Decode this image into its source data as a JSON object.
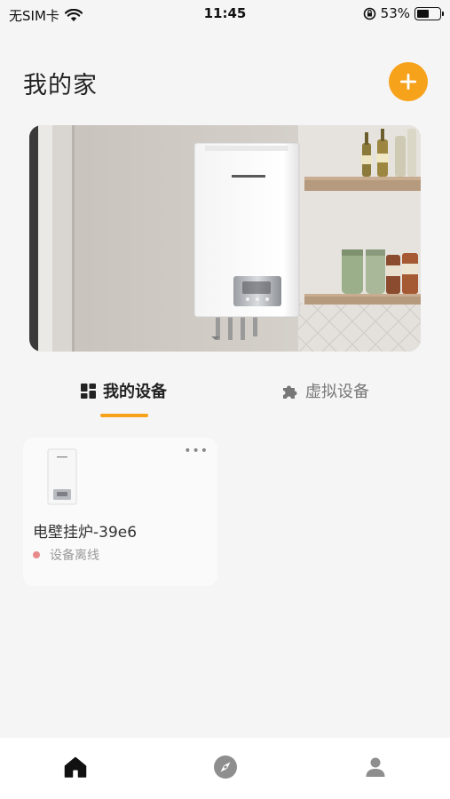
{
  "status_bar": {
    "carrier": "无SIM卡",
    "time": "11:45",
    "battery_percent": "53%",
    "battery_level": 0.53,
    "icons": [
      "wifi-icon",
      "orientation-lock-icon",
      "battery-icon"
    ]
  },
  "header": {
    "title": "我的家",
    "add_icon": "plus-icon",
    "accent_color": "#f7a21b"
  },
  "banner": {
    "image": "wall-mounted-boiler-kitchen-photo"
  },
  "tabs": [
    {
      "label": "我的设备",
      "icon": "grid-icon",
      "active": true
    },
    {
      "label": "虚拟设备",
      "icon": "puzzle-icon",
      "active": false
    }
  ],
  "devices": [
    {
      "name": "电壁挂炉-39e6",
      "status": "设备离线",
      "status_color": "#e88a8a",
      "more_icon": "more-icon"
    }
  ],
  "bottom_nav": {
    "items": [
      {
        "icon": "home-icon",
        "active": true
      },
      {
        "icon": "compass-icon",
        "active": false
      },
      {
        "icon": "user-icon",
        "active": false
      }
    ]
  }
}
